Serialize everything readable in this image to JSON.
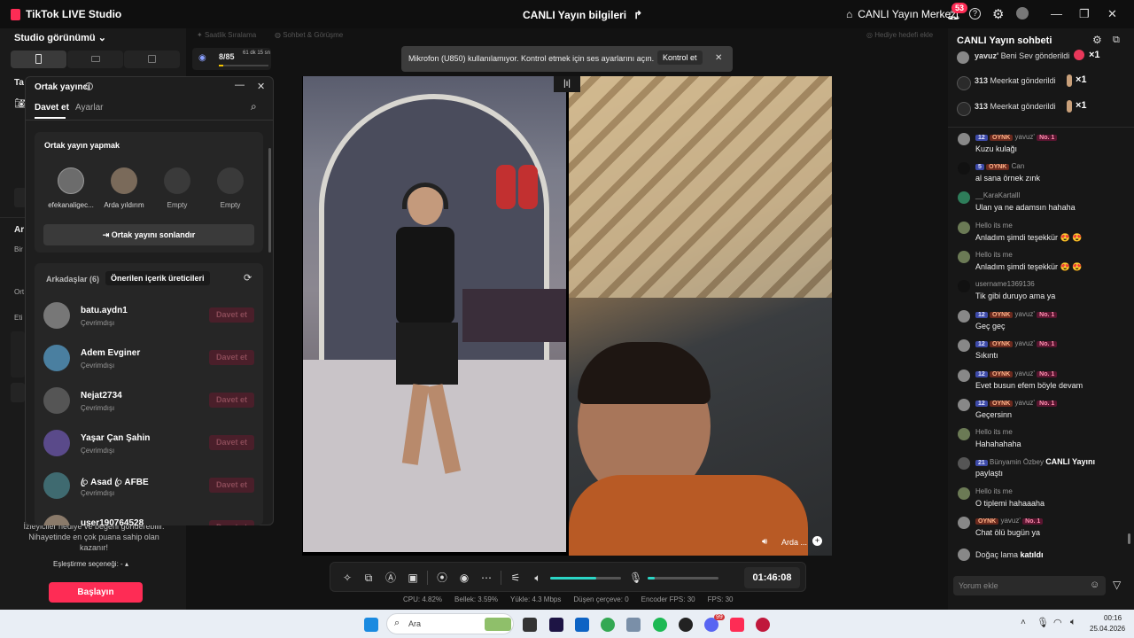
{
  "app": {
    "title": "TikTok LIVE Studio",
    "center_title": "CANLI Yayın bilgileri",
    "live_center": "CANLI Yayın Merkezi",
    "notif_count": "53"
  },
  "left": {
    "studio_view": "Studio görünümü",
    "stats": {
      "count": "8/85",
      "time": "61 dk 15 sn"
    },
    "truncated": [
      "Ta",
      "Ar",
      "Bir",
      "Ort",
      "Eti"
    ],
    "hint": "İzleyiciler hediye ve beğeni gönderebilir. Nihayetinde en çok puana sahip olan kazanır!",
    "matching": "Eşleştirme seçeneği: -",
    "start": "Başlayın"
  },
  "topbar": {
    "hourly": "Saatlik Sıralama",
    "chat_players": "Sohbet & Görüşme",
    "gift_goal": "Hediye hedefi ekle"
  },
  "popup": {
    "title": "Ortak yayıncı",
    "tabs": [
      "Davet et",
      "Ayarlar"
    ],
    "section": "Ortak yayın yapmak",
    "hosts": [
      {
        "name": "efekanaligec..."
      },
      {
        "name": "Arda yıldırım"
      },
      {
        "name": "Empty"
      },
      {
        "name": "Empty"
      }
    ],
    "end_button": "Ortak yayını sonlandır",
    "list_tabs": [
      "Arkadaşlar (6)",
      "Önerilen içerik üreticileri"
    ],
    "invite_label": "Davet et",
    "friends": [
      {
        "name": "batu.aydn1",
        "status": "Çevrimdışı"
      },
      {
        "name": "Adem Evginer",
        "status": "Çevrimdışı"
      },
      {
        "name": "Nejat2734",
        "status": "Çevrimdışı"
      },
      {
        "name": "Yaşar Çan Şahin",
        "status": "Çevrimdışı"
      },
      {
        "name": "ꦿ Asad ꦿ AFBE",
        "status": "Çevrimdışı"
      },
      {
        "name": "user190764528",
        "status": ""
      }
    ]
  },
  "toast": {
    "text": "Mikrofon (U850) kullanılamıyor. Kontrol etmek için ses ayarlarını açın.",
    "button": "Kontrol et"
  },
  "preview": {
    "guest_label": "Arda ..."
  },
  "toolbar": {
    "volume_level": 0.65,
    "mic_level": 0.1,
    "timer": "01:46:08"
  },
  "status": [
    {
      "label": "CPU:",
      "value": "4.82%"
    },
    {
      "label": "Bellek:",
      "value": "3.59%"
    },
    {
      "label": "Yükle:",
      "value": "4.3 Mbps"
    },
    {
      "label": "Düşen çerçeve:",
      "value": "0"
    },
    {
      "label": "Encoder FPS:",
      "value": "30"
    },
    {
      "label": "FPS:",
      "value": "30"
    }
  ],
  "chat": {
    "title": "CANLI Yayın sohbeti",
    "gifts": [
      {
        "user": "yavuz'",
        "text": "Beni Sev gönderildi",
        "count": "×1"
      },
      {
        "user": "313",
        "text": "Meerkat gönderildi",
        "count": "×1"
      },
      {
        "user": "313",
        "text": "Meerkat gönderildi",
        "count": "×1"
      }
    ],
    "messages": [
      {
        "lv": "12",
        "oy": "OYNK",
        "user": "yavuz'",
        "no1": "No. 1",
        "text": "Kuzu kulağı"
      },
      {
        "lv": "5",
        "oy": "OYNK",
        "user": "Can",
        "no1": "",
        "text": "al sana örnek zınk"
      },
      {
        "lv": "",
        "oy": "",
        "user": "__KaraKartalll",
        "no1": "",
        "text": "Ulan ya ne adamsın hahaha"
      },
      {
        "lv": "",
        "oy": "",
        "user": "Hello its me",
        "no1": "",
        "text": "Anladım şimdi teşekkür 😍 😍"
      },
      {
        "lv": "",
        "oy": "",
        "user": "Hello its me",
        "no1": "",
        "text": "Anladım şimdi teşekkür 😍 😍"
      },
      {
        "lv": "",
        "oy": "",
        "user": "username1369136",
        "no1": "",
        "text": "Tik gibi duruyo ama ya"
      },
      {
        "lv": "12",
        "oy": "OYNK",
        "user": "yavuz'",
        "no1": "No. 1",
        "text": "Geç geç"
      },
      {
        "lv": "12",
        "oy": "OYNK",
        "user": "yavuz'",
        "no1": "No. 1",
        "text": "Sıkıntı"
      },
      {
        "lv": "12",
        "oy": "OYNK",
        "user": "yavuz'",
        "no1": "No. 1",
        "text": "Evet busun efem böyle devam"
      },
      {
        "lv": "12",
        "oy": "OYNK",
        "user": "yavuz'",
        "no1": "No. 1",
        "text": "Geçersinn"
      },
      {
        "lv": "",
        "oy": "",
        "user": "Hello its me",
        "no1": "",
        "text": "Hahahahaha"
      },
      {
        "lv": "21",
        "oy": "",
        "user": "Bünyamin Özbey",
        "no1": "",
        "text": "paylaştı",
        "extra": "CANLI Yayını"
      },
      {
        "lv": "",
        "oy": "",
        "user": "Hello its me",
        "no1": "",
        "text": "O tiplemi hahaaaha"
      },
      {
        "lv": "",
        "oy": "OYNK",
        "user": "yavuz'",
        "no1": "No. 1",
        "text": "Chat ölü bugün ya"
      }
    ],
    "joined": {
      "user": "Doğaç lama",
      "text": "katıldı"
    },
    "input_placeholder": "Yorum ekle"
  },
  "taskbar": {
    "search": "Ara",
    "badge": "99",
    "time": "00:16",
    "date": "25.04.2026"
  }
}
